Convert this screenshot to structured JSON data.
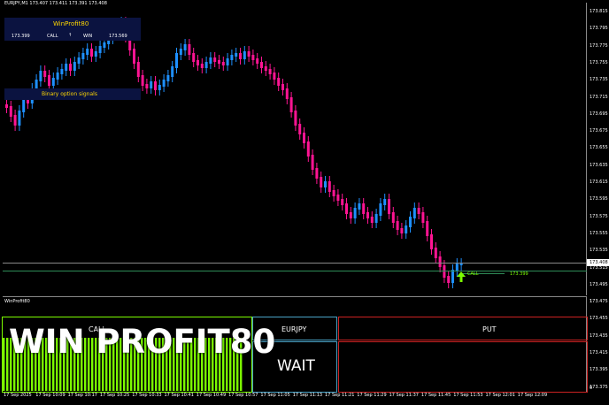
{
  "symbol_header": "EURJPY,M1  173.407 173.411 173.391 173.408",
  "info_panel": {
    "title": "WinProfit80",
    "row": [
      "173.399",
      "CALL",
      "↑",
      "WIN",
      "173.569"
    ],
    "footer": "Binary option signals"
  },
  "price_ticks": [
    "173.815",
    "173.795",
    "173.775",
    "173.755",
    "173.735",
    "173.715",
    "173.695",
    "173.675",
    "173.655",
    "173.635",
    "173.615",
    "173.595",
    "173.575",
    "173.555",
    "173.535",
    "173.515",
    "173.495",
    "173.475",
    "173.455",
    "173.435",
    "173.415",
    "173.408",
    "173.395",
    "173.375"
  ],
  "current_price": "173.408",
  "signal_line": {
    "label": "CALL",
    "price": "173.399"
  },
  "indicator_label": "WinProfit80",
  "indicator_level": "1",
  "indicator_level_low": "0",
  "boxes": {
    "call": "CALL",
    "pair": "EURJPY",
    "put": "PUT",
    "status": "WAIT"
  },
  "watermark": "WIN PROFIT80",
  "time_labels": [
    "17 Sep 2025",
    "17 Sep 10:09",
    "17 Sep 10:17",
    "17 Sep 10:25",
    "17 Sep 10:33",
    "17 Sep 10:41",
    "17 Sep 10:49",
    "17 Sep 10:57",
    "17 Sep 11:05",
    "17 Sep 11:13",
    "17 Sep 11:21",
    "17 Sep 11:29",
    "17 Sep 11:37",
    "17 Sep 11:45",
    "17 Sep 11:53",
    "17 Sep 12:01",
    "17 Sep 12:09"
  ],
  "colors": {
    "bull": "#1e90ff",
    "bear": "#ff1493",
    "accent_green": "#7cfc00",
    "panel_bg": "#0b1340"
  }
}
